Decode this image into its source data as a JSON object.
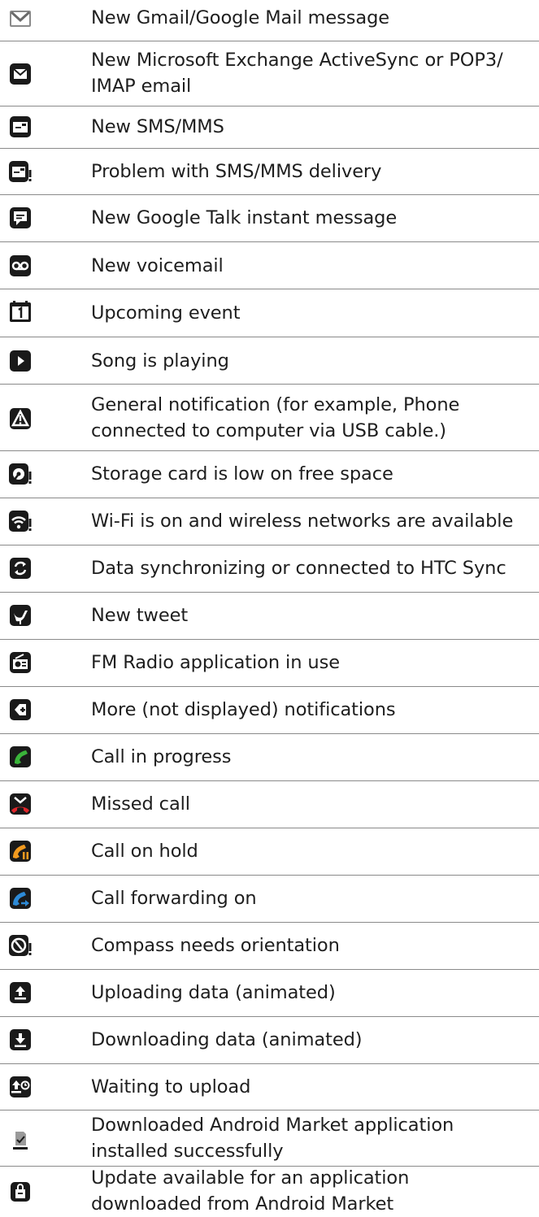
{
  "rows": [
    {
      "icon": "gmail-icon",
      "text": "New Gmail/Google Mail message"
    },
    {
      "icon": "email-icon",
      "text": "New Microsoft Exchange ActiveSync or POP3/\nIMAP email"
    },
    {
      "icon": "sms-icon",
      "text": "New SMS/MMS"
    },
    {
      "icon": "sms-problem-icon",
      "text": "Problem with SMS/MMS delivery"
    },
    {
      "icon": "google-talk-icon",
      "text": "New Google Talk instant message"
    },
    {
      "icon": "voicemail-icon",
      "text": "New voicemail"
    },
    {
      "icon": "calendar-icon",
      "text": "Upcoming event"
    },
    {
      "icon": "play-icon",
      "text": "Song is playing"
    },
    {
      "icon": "warning-icon",
      "text": "General notification (for example, Phone\nconnected to computer via USB cable.)"
    },
    {
      "icon": "storage-low-icon",
      "text": "Storage card is low on free space"
    },
    {
      "icon": "wifi-icon",
      "text": "Wi-Fi is on and wireless networks are available"
    },
    {
      "icon": "sync-icon",
      "text": "Data synchronizing or connected to HTC Sync"
    },
    {
      "icon": "tweet-icon",
      "text": "New tweet"
    },
    {
      "icon": "fm-radio-icon",
      "text": "FM Radio application in use"
    },
    {
      "icon": "more-notifications-icon",
      "text": "More (not displayed) notifications"
    },
    {
      "icon": "call-in-progress-icon",
      "text": "Call in progress"
    },
    {
      "icon": "missed-call-icon",
      "text": "Missed call"
    },
    {
      "icon": "call-on-hold-icon",
      "text": "Call on hold"
    },
    {
      "icon": "call-forwarding-icon",
      "text": "Call forwarding on"
    },
    {
      "icon": "compass-icon",
      "text": "Compass needs orientation"
    },
    {
      "icon": "upload-icon",
      "text": "Uploading data (animated)"
    },
    {
      "icon": "download-icon",
      "text": "Downloading data (animated)"
    },
    {
      "icon": "waiting-upload-icon",
      "text": "Waiting to upload"
    },
    {
      "icon": "market-installed-icon",
      "text": "Downloaded Android Market application\ninstalled successfully"
    },
    {
      "icon": "market-update-icon",
      "text": "Update available for an application\ndownloaded from Android Market"
    }
  ]
}
